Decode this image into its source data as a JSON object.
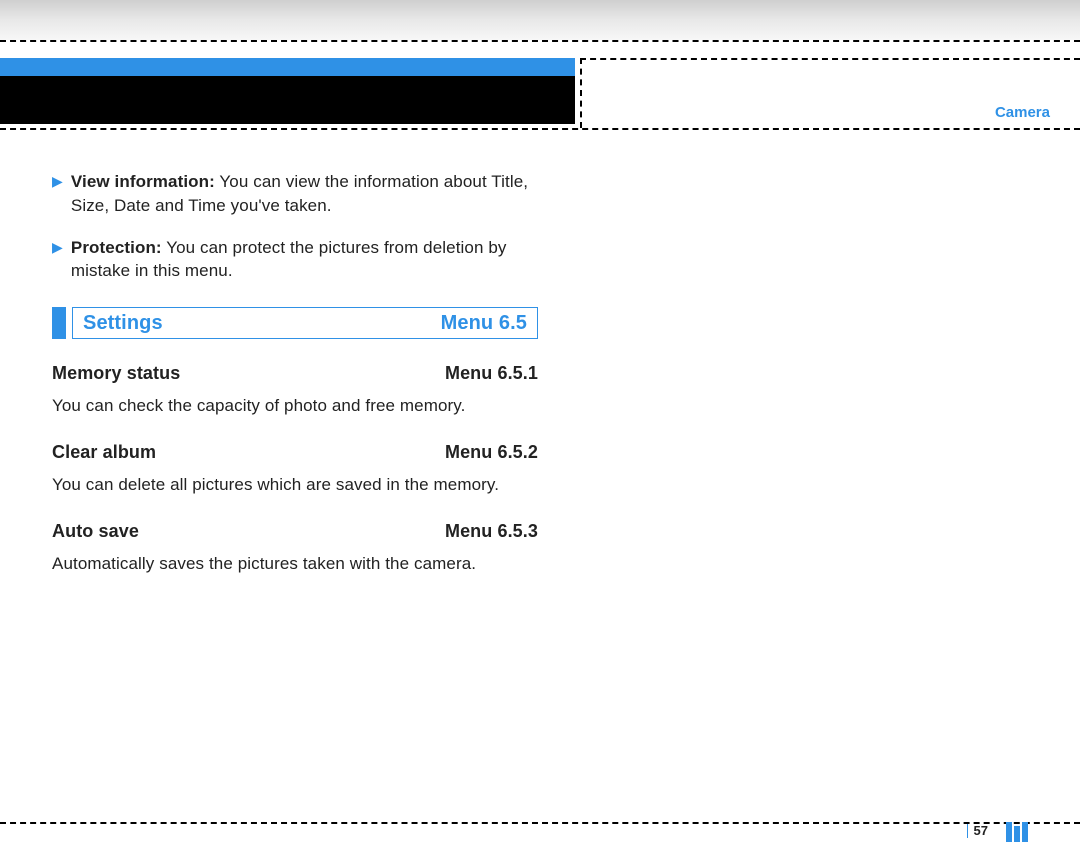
{
  "header": {
    "section": "Camera"
  },
  "bullets": [
    {
      "label": "View information:",
      "text": " You can view the information about Title, Size, Date and Time you've taken."
    },
    {
      "label": "Protection:",
      "text": " You can protect the pictures from deletion by mistake in this menu."
    }
  ],
  "heading": {
    "title": "Settings",
    "menu": "Menu 6.5"
  },
  "subs": [
    {
      "title": "Memory status",
      "menu": "Menu 6.5.1",
      "body": "You can check the capacity of photo and free memory."
    },
    {
      "title": "Clear album",
      "menu": "Menu 6.5.2",
      "body": "You can delete all pictures which are saved in the memory."
    },
    {
      "title": "Auto save",
      "menu": "Menu 6.5.3",
      "body": "Automatically saves the pictures taken with the camera."
    }
  ],
  "page": "57"
}
